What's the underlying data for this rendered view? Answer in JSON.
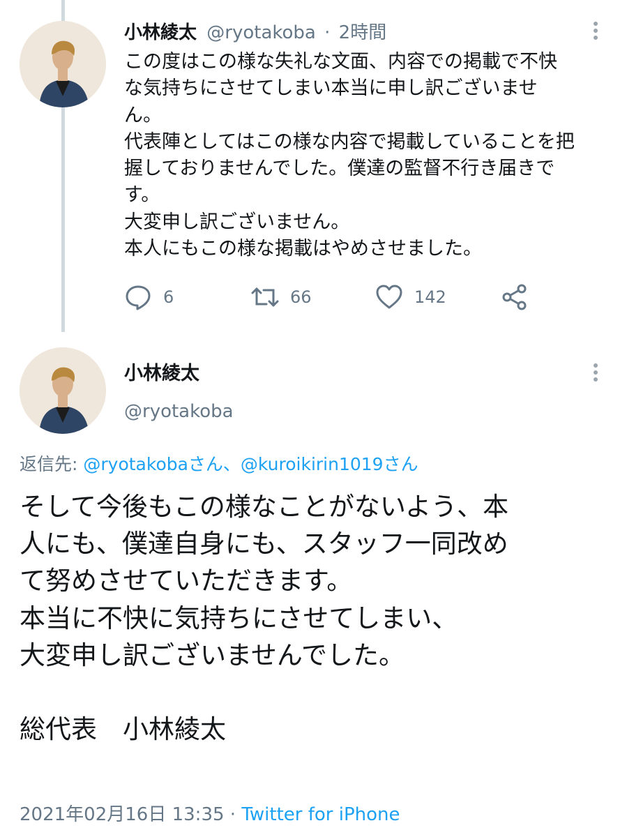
{
  "tweet1": {
    "name": "小林綾太",
    "handle": "@ryotakoba",
    "separator": "·",
    "time": "2時間",
    "text_lines": [
      "この度はこの様な失礼な文面、内容での掲載で不快",
      "な気持ちにさせてしまい本当に申し訳ございませ",
      "ん。",
      "代表陣としてはこの様な内容で掲載していることを把",
      "握しておりませんでした。僕達の監督不行き届きで",
      "す。",
      "大変申し訳ございません。",
      "本人にもこの様な掲載はやめさせました。"
    ],
    "replies": "6",
    "retweets": "66",
    "likes": "142"
  },
  "tweet2": {
    "name": "小林綾太",
    "handle": "@ryotakoba",
    "reply_label": "返信先: ",
    "reply_targets": "@ryotakobaさん、@kuroikirin1019さん",
    "text_lines": [
      "そして今後もこの様なことがないよう、本",
      "人にも、僕達自身にも、スタッフ一同改め",
      "て努めさせていただきます。",
      "本当に不快に気持ちにさせてしまい、",
      "大変申し訳ございませんでした。",
      "",
      "総代表　小林綾太"
    ],
    "timestamp": "2021年02月16日 13:35",
    "separator": "·",
    "source": "Twitter for iPhone"
  },
  "icons": {
    "reply": "reply-icon",
    "retweet": "retweet-icon",
    "like": "heart-icon",
    "share": "share-icon",
    "more": "more-options-icon"
  },
  "colors": {
    "text": "#14171a",
    "secondary": "#657786",
    "link": "#1da1f2",
    "thread_line": "#cfd9de"
  }
}
